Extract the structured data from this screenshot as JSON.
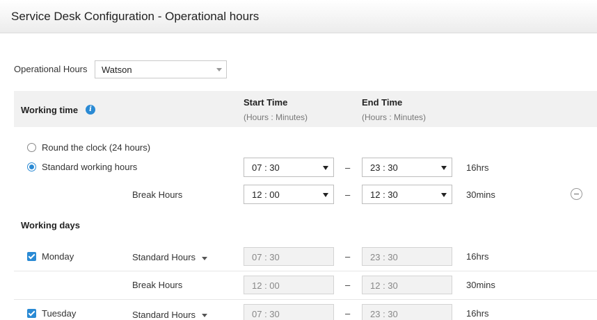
{
  "header": {
    "title": "Service Desk Configuration - Operational hours"
  },
  "operational_hours": {
    "label": "Operational Hours",
    "selected": "Watson"
  },
  "working_time": {
    "heading": "Working time",
    "start_time": {
      "label": "Start Time",
      "sub": "(Hours : Minutes)"
    },
    "end_time": {
      "label": "End Time",
      "sub": "(Hours : Minutes)"
    },
    "options": [
      {
        "label": "Round the clock (24 hours)",
        "selected": false
      },
      {
        "label": "Standard working hours",
        "selected": true
      }
    ],
    "standard": {
      "start": "07 : 30",
      "end": "23 : 30",
      "duration": "16hrs"
    },
    "break": {
      "label": "Break Hours",
      "start": "12 : 00",
      "end": "12 : 30",
      "duration": "30mins"
    },
    "dash": "–"
  },
  "working_days": {
    "heading": "Working days",
    "days": [
      {
        "name": "Monday",
        "checked": true,
        "hours_type": "Standard Hours",
        "start": "07 : 30",
        "end": "23 : 30",
        "duration": "16hrs",
        "break_label": "Break Hours",
        "break_start": "12 : 00",
        "break_end": "12 : 30",
        "break_duration": "30mins"
      },
      {
        "name": "Tuesday",
        "checked": true,
        "hours_type": "Standard Hours",
        "start": "07 : 30",
        "end": "23 : 30",
        "duration": "16hrs"
      }
    ]
  },
  "colors": {
    "accent": "#2a8ad4",
    "band": "#f1f1f1"
  }
}
